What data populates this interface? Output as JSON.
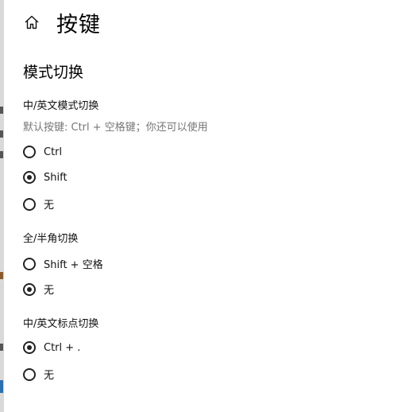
{
  "header": {
    "title": "按键",
    "home_icon": "home-icon"
  },
  "section": {
    "title": "模式切换"
  },
  "groups": [
    {
      "title": "中/英文模式切换",
      "hint": "默认按键: Ctrl + 空格键；你还可以使用",
      "options": [
        {
          "label": "Ctrl",
          "selected": false
        },
        {
          "label": "Shift",
          "selected": true
        },
        {
          "label": "无",
          "selected": false
        }
      ]
    },
    {
      "title": "全/半角切换",
      "options": [
        {
          "label": "Shift + 空格",
          "selected": false
        },
        {
          "label": "无",
          "selected": true
        }
      ]
    },
    {
      "title": "中/英文标点切换",
      "options": [
        {
          "label": "Ctrl + .",
          "selected": true
        },
        {
          "label": "无",
          "selected": false
        }
      ]
    }
  ]
}
